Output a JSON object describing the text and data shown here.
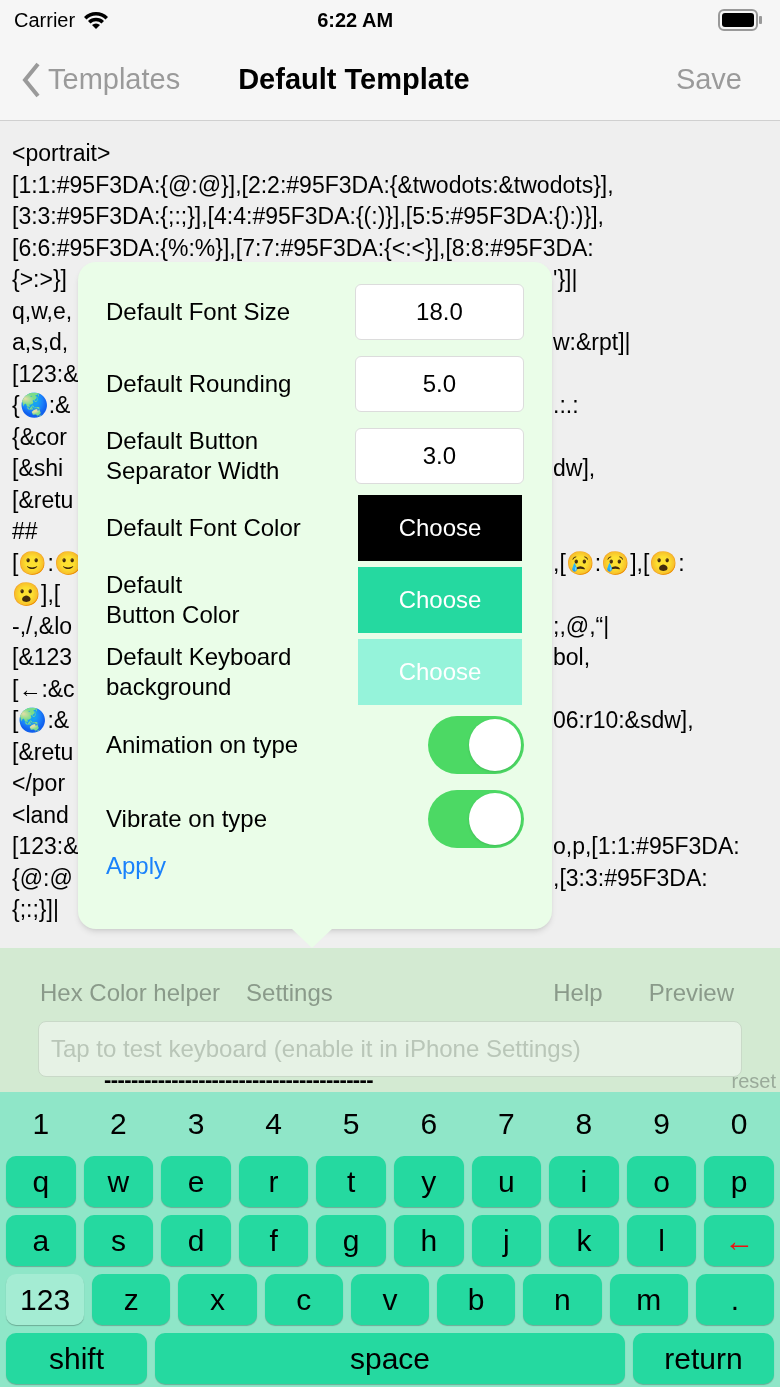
{
  "status_bar": {
    "carrier": "Carrier",
    "time": "6:22 AM"
  },
  "nav": {
    "back": "Templates",
    "title": "Default Template",
    "action": "Save"
  },
  "editor_lines": [
    {
      "left": "<portrait>"
    },
    {
      "left": "[1:1:#95F3DA:{@:@}],[2:2:#95F3DA:{&twodots:&twodots}],"
    },
    {
      "left": "[3:3:#95F3DA:{;:;}],[4:4:#95F3DA:{(:)}],[5:5:#95F3DA:{):)}],"
    },
    {
      "left": "[6:6:#95F3DA:{%:%}],[7:7:#95F3DA:{<:<}],[8:8:#95F3DA:"
    },
    {
      "left": "{>:>}]",
      "right": "'}]|"
    },
    {
      "left": "q,w,e,"
    },
    {
      "left": "a,s,d,",
      "right": "w:&rpt]|"
    },
    {
      "left": "[123:&"
    },
    {
      "left": "{🌏:&",
      "right": ".:.:"
    },
    {
      "left": "{&cor"
    },
    {
      "left": "[&shi",
      "right": "dw],"
    },
    {
      "left": "[&retu"
    },
    {
      "left": "##"
    },
    {
      "left": "[🙂:🙂",
      "right": ",[😢:😢],[😮:"
    },
    {
      "left": "😮],["
    },
    {
      "left": "-,/,&lo",
      "right": ";,@,“|"
    },
    {
      "left": "[&123",
      "right": "bol,"
    },
    {
      "left": "[←:&c"
    },
    {
      "left": "[🌏:&",
      "right": "06:r10:&sdw],"
    },
    {
      "left": "[&retu"
    },
    {
      "left": "</por"
    },
    {
      "left": "<land"
    },
    {
      "left": "[123:&",
      "right": "o,p,[1:1:#95F3DA:"
    },
    {
      "left": "{@:@",
      "right": ",[3:3:#95F3DA:"
    },
    {
      "left": "{;:;}]|"
    }
  ],
  "settings": {
    "rows": [
      {
        "kind": "field",
        "label": "Default Font Size",
        "value": "18.0"
      },
      {
        "kind": "field",
        "label": "Default Rounding",
        "value": "5.0"
      },
      {
        "kind": "field",
        "label": "Default Button Separator Width",
        "value": "3.0"
      },
      {
        "kind": "color",
        "label": "Default Font Color",
        "button": "Choose",
        "color": "#000000"
      },
      {
        "kind": "color",
        "label": "Default\nButton Color",
        "button": "Choose",
        "color": "#25d9a0"
      },
      {
        "kind": "color",
        "label": "Default Keyboard background",
        "button": "Choose",
        "color": "#95f3da"
      },
      {
        "kind": "toggle",
        "label": "Animation on type",
        "on": true
      },
      {
        "kind": "toggle",
        "label": "Vibrate on type",
        "on": true
      }
    ],
    "apply": "Apply"
  },
  "toolbar": {
    "left": [
      "Hex Color helper",
      "Settings"
    ],
    "right": [
      "Help",
      "Preview"
    ]
  },
  "test_field": {
    "placeholder": "Tap to test keyboard (enable it in iPhone Settings)"
  },
  "separator": "----------------------------------------",
  "reset": "reset",
  "keyboard": [
    {
      "kind": "digits",
      "keys": [
        {
          "label": "1"
        },
        {
          "label": "2"
        },
        {
          "label": "3"
        },
        {
          "label": "4"
        },
        {
          "label": "5"
        },
        {
          "label": "6"
        },
        {
          "label": "7"
        },
        {
          "label": "8"
        },
        {
          "label": "9"
        },
        {
          "label": "0"
        }
      ]
    },
    {
      "kind": "keys",
      "keys": [
        {
          "label": "q",
          "kind": "key"
        },
        {
          "label": "w",
          "kind": "key"
        },
        {
          "label": "e",
          "kind": "key"
        },
        {
          "label": "r",
          "kind": "key"
        },
        {
          "label": "t",
          "kind": "key"
        },
        {
          "label": "y",
          "kind": "key"
        },
        {
          "label": "u",
          "kind": "key"
        },
        {
          "label": "i",
          "kind": "key"
        },
        {
          "label": "o",
          "kind": "key"
        },
        {
          "label": "p",
          "kind": "key"
        }
      ]
    },
    {
      "kind": "keys",
      "keys": [
        {
          "label": "a",
          "kind": "key"
        },
        {
          "label": "s",
          "kind": "key"
        },
        {
          "label": "d",
          "kind": "key"
        },
        {
          "label": "f",
          "kind": "key"
        },
        {
          "label": "g",
          "kind": "key"
        },
        {
          "label": "h",
          "kind": "key"
        },
        {
          "label": "j",
          "kind": "key"
        },
        {
          "label": "k",
          "kind": "key"
        },
        {
          "label": "l",
          "kind": "key"
        },
        {
          "label": "←",
          "kind": "delete"
        }
      ]
    },
    {
      "kind": "keys",
      "keys": [
        {
          "label": "123",
          "kind": "mode"
        },
        {
          "label": "z",
          "kind": "key"
        },
        {
          "label": "x",
          "kind": "key"
        },
        {
          "label": "c",
          "kind": "key"
        },
        {
          "label": "v",
          "kind": "key"
        },
        {
          "label": "b",
          "kind": "key"
        },
        {
          "label": "n",
          "kind": "key"
        },
        {
          "label": "m",
          "kind": "key"
        },
        {
          "label": ".",
          "kind": "key"
        }
      ]
    },
    {
      "kind": "keys",
      "keys": [
        {
          "label": "shift",
          "kind": "wide"
        },
        {
          "label": "space",
          "kind": "space"
        },
        {
          "label": "return",
          "kind": "wide"
        }
      ]
    }
  ]
}
